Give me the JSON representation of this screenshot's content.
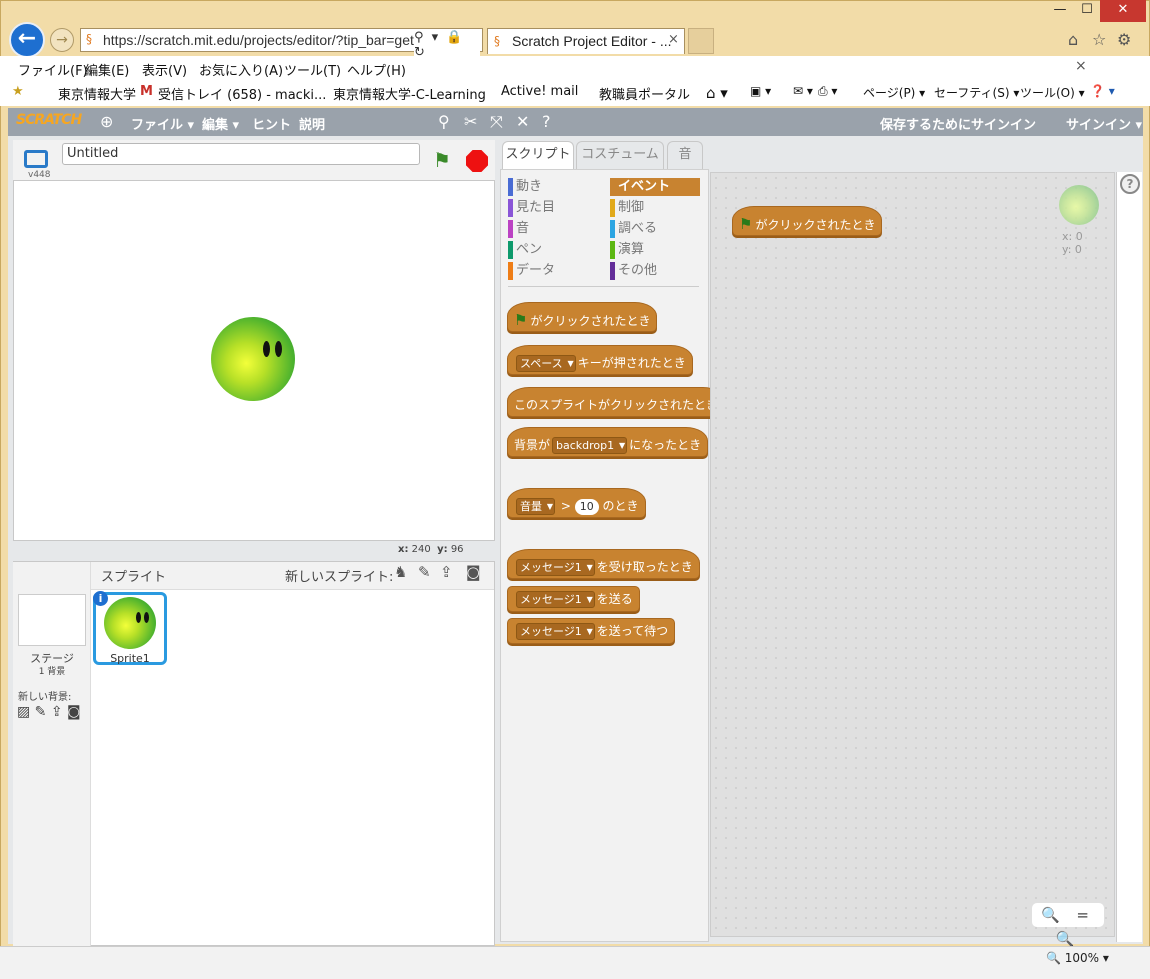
{
  "browser": {
    "url": "https://scratch.mit.edu/projects/editor/?tip_bar=get",
    "tab_title": "Scratch Project Editor - ...",
    "tab_close": "×",
    "win_min": "—",
    "win_max": "☐",
    "win_close": "✕",
    "addr_tools": "⚲ ▾ 🔒 ↻",
    "menu": [
      "ファイル(F)",
      "編集(E)",
      "表示(V)",
      "お気に入り(A)",
      "ツール(T)",
      "ヘルプ(H)"
    ],
    "favorites": [
      "東京情報大学",
      "受信トレイ (658) - macki...",
      "東京情報大学-C-Learning",
      "Active! mail",
      "教職員ポータル"
    ],
    "commands": [
      "ページ(P) ▾",
      "セーフティ(S) ▾",
      "ツール(O) ▾"
    ],
    "zoom": "100%"
  },
  "scratch": {
    "logo": "SCRATCH",
    "menu": [
      "ファイル ▾",
      "編集 ▾",
      "ヒント",
      "説明"
    ],
    "signin_save": "保存するためにサインイン",
    "signin": "サインイン ▾",
    "project_title": "Untitled",
    "version": "v448",
    "mouse_x_label": "x:",
    "mouse_x": "240",
    "mouse_y_label": "y:",
    "mouse_y": "96",
    "sprites_label": "スプライト",
    "new_sprite_label": "新しいスプライト:",
    "stage_label": "ステージ",
    "stage_backdrops": "1 背景",
    "new_backdrop_label": "新しい背景:",
    "sprite_name": "Sprite1",
    "tabs": [
      "スクリプト",
      "コスチューム",
      "音"
    ],
    "categories_left": [
      "動き",
      "見た目",
      "音",
      "ペン",
      "データ"
    ],
    "categories_right": [
      "イベント",
      "制御",
      "調べる",
      "演算",
      "その他"
    ],
    "category_colors": {
      "motion": "#4a6cd4",
      "looks": "#8a55d7",
      "sound": "#bb42c3",
      "pen": "#0e9a6c",
      "data": "#ee7d16",
      "events": "#c88330",
      "control": "#e1a91a",
      "sensing": "#2ca5e2",
      "operators": "#5cb712",
      "more": "#632d99"
    },
    "blocks": {
      "when_flag": "がクリックされたとき",
      "key_dropdown": "スペース",
      "when_key": "キーが押されたとき",
      "when_sprite_clicked": "このスプライトがクリックされたとき",
      "backdrop_prefix": "背景が",
      "backdrop_dropdown": "backdrop1",
      "backdrop_suffix": "になったとき",
      "loudness_dropdown": "音量",
      "gt": ">",
      "loudness_value": "10",
      "loudness_suffix": "のとき",
      "msg_dropdown": "メッセージ1",
      "when_receive": "を受け取ったとき",
      "broadcast": "を送る",
      "broadcast_wait": "を送って待つ"
    },
    "script_block": "がクリックされたとき",
    "sprite_x": "x: 0",
    "sprite_y": "y: 0",
    "help": "?",
    "zoom_controls": "🔍 = 🔍"
  }
}
